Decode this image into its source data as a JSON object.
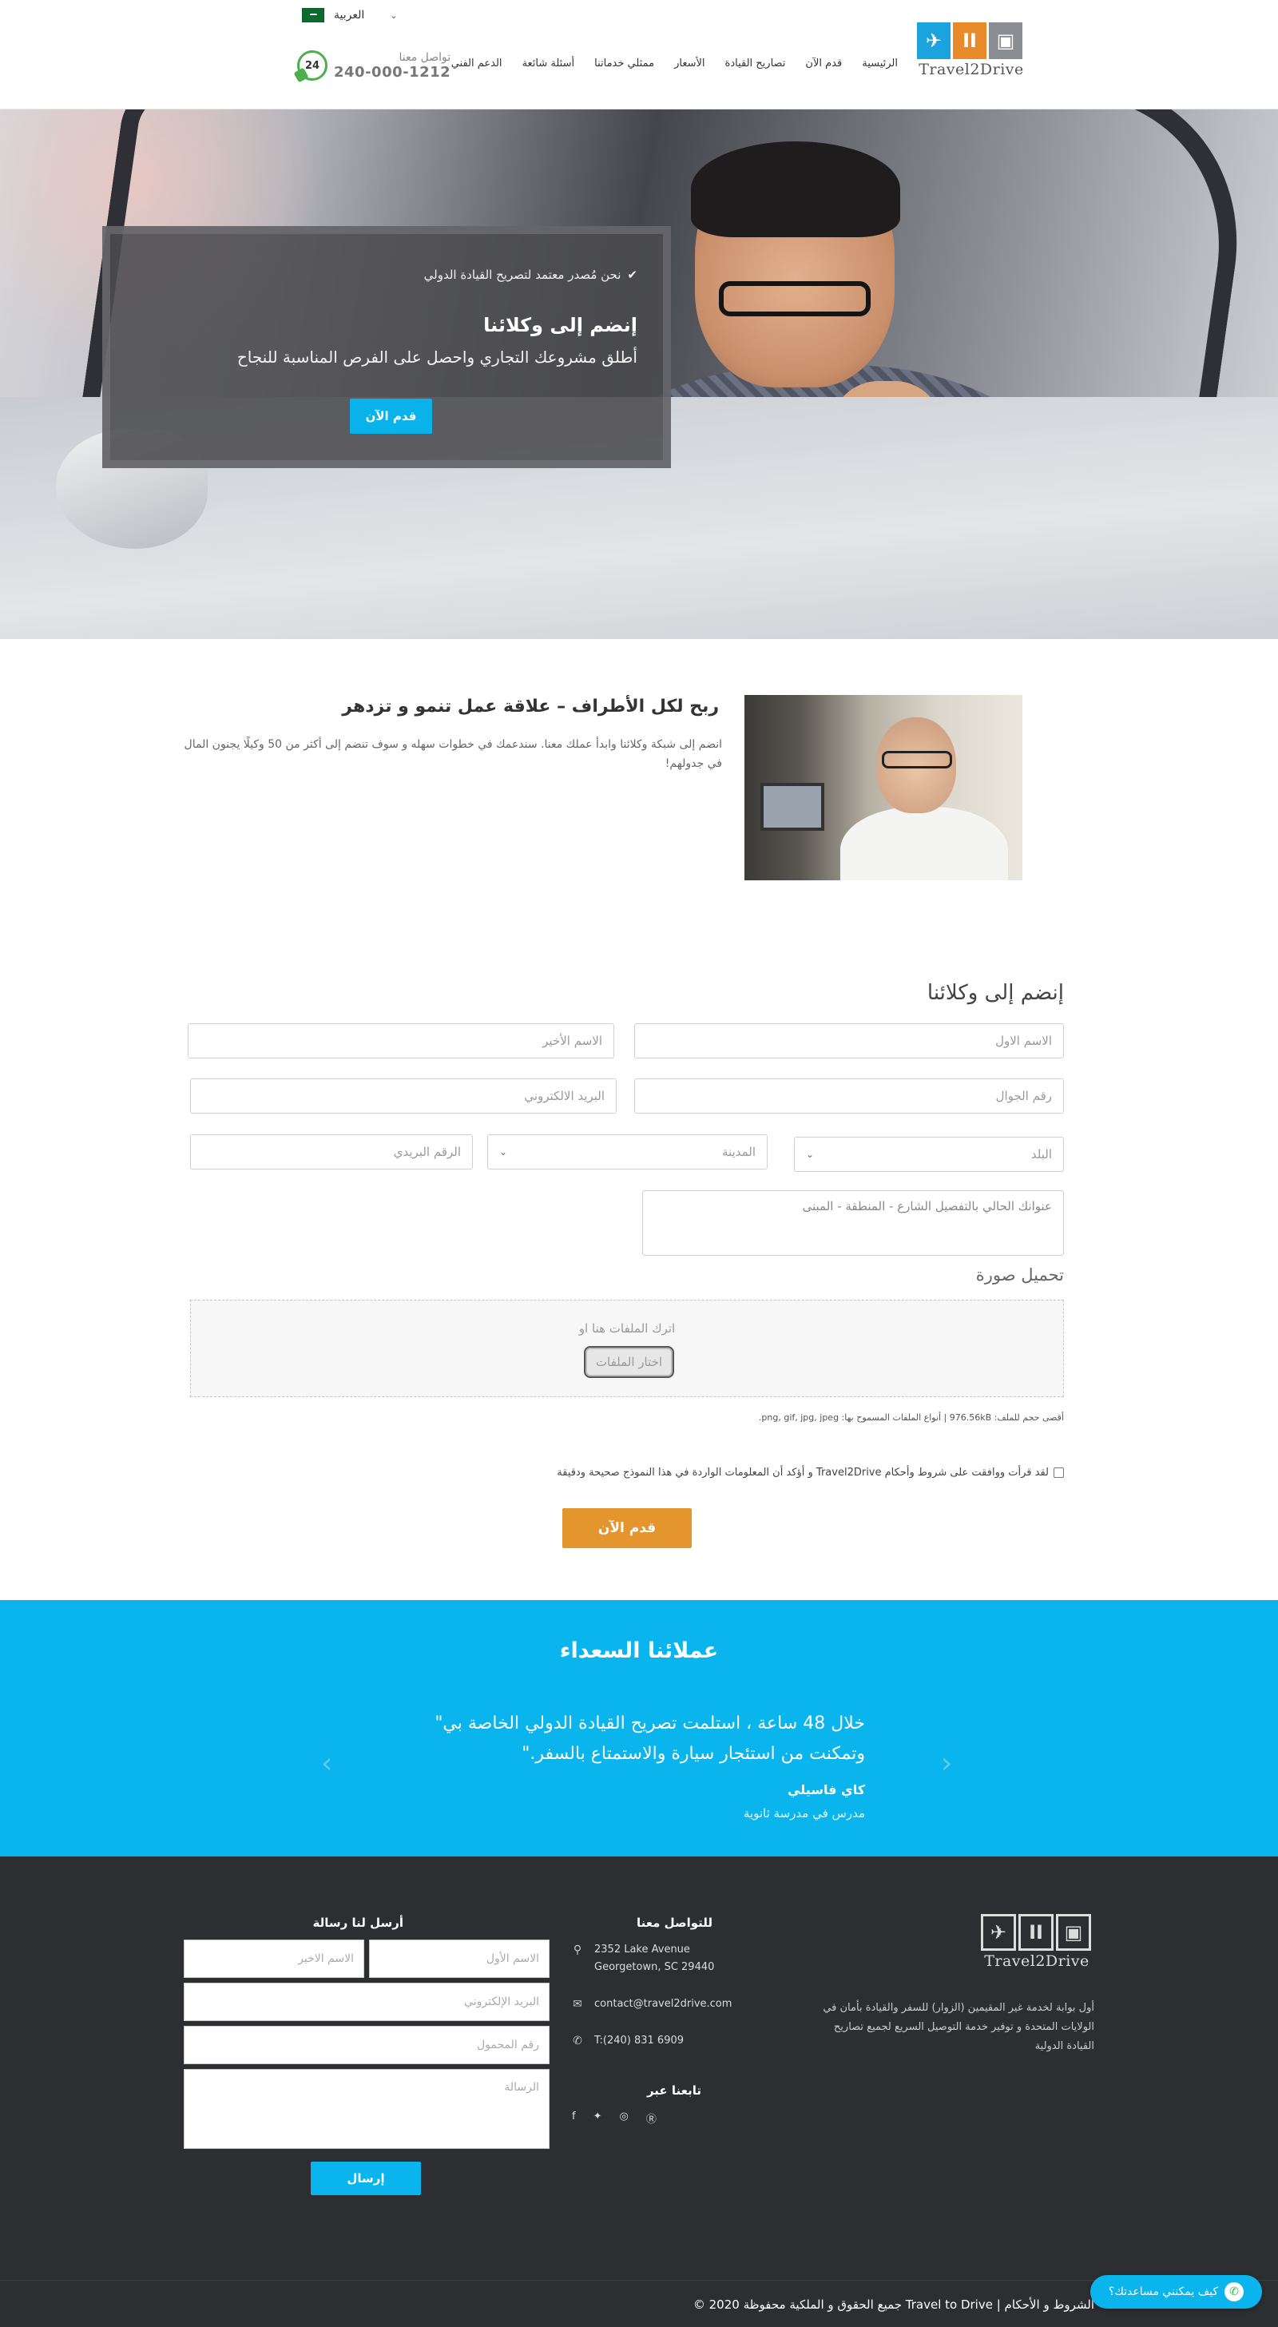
{
  "header": {
    "language": "العربية",
    "phone_label": "تواصل معنا",
    "phone_number": "240-000-1212",
    "phone_badge": "24",
    "nav": [
      "الرئيسية",
      "قدم الآن",
      "تصاريح القيادة",
      "الأسعار",
      "ممثلي خدماتنا",
      "أسئلة شائعة",
      "الدعم الفني"
    ],
    "logo_text": "Travel2Drive",
    "logo_colors": [
      "#1aa3dc",
      "#e8892a",
      "#8a8d92"
    ]
  },
  "hero": {
    "check_text": "نحن مُصدر معتمد لتصريح القيادة الدولي",
    "title": "إنضم إلى وكلائنا",
    "subtitle": "أطلق مشروعك التجاري واحصل على الفرص المناسبة للنجاح",
    "cta": "قدم الآن"
  },
  "partner": {
    "title": "ربح لكل الأطراف – علاقة عمل تنمو و تزدهر",
    "text": "انضم إلى شبكة وكلائنا وابدأ عملك معنا. سندعمك في خطوات سهله و سوف تنضم إلى أكثر من 50 وكيلًا يجنون المال في جدولهم!"
  },
  "form": {
    "title": "إنضم إلى وكلائنا",
    "first_name": "الاسم الاول",
    "last_name": "الاسم الأخير",
    "mobile": "رقم الجوال",
    "email": "البريد الالكتروني",
    "country": "البلد",
    "city": "المدينة",
    "postal": "الرقم البريدي",
    "address": "عنوانك الحالي بالتفصيل الشارع - المنطقة - المبنى",
    "upload_title": "تحميل صورة",
    "drop_text": "اترك الملفات هنا او",
    "choose_files": "اختار الملفات",
    "upload_note": "أقصى حجم للملف: 976.56kB | أنواع الملفات المسموح بها: png, gif, jpg, jpeg.",
    "agree_text": "لقد قرأت ووافقت على شروط وأحكام Travel2Drive و أؤكد أن المعلومات الواردة في هذا النموذج صحيحة ودقيقة",
    "submit": "قدم الآن"
  },
  "testimonials": {
    "title": "عملائنا السعداء",
    "quote": "خلال 48 ساعة ، استلمت تصريح القيادة الدولي الخاصة بي\" وتمكنت من استئجار سيارة والاستمتاع بالسفر.\"",
    "name": "كاي فاسيلي",
    "role": "مدرس في مدرسة ثانوية",
    "prev": "‹",
    "next": "›"
  },
  "footer": {
    "about": "أول بوابة لخدمة غير المقيمين (الزوار) للسفر والقيادة بأمان في الولايات المتحدة و توفير خدمة التوصيل السريع لجميع تصاريح القيادة الدولية",
    "contact_title": "للتواصل معنا",
    "address_line1": "2352 Lake Avenue",
    "address_line2": "Georgetown, SC 29440",
    "email": "contact@travel2drive.com",
    "phone": "T:(240) 831 6909",
    "follow_title": "تابعنا عبر",
    "message_title": "أرسل لنا رسالة",
    "f_first": "الاسم الأول",
    "f_last": "الاسم الاخير",
    "f_email": "البريد الإلكتروني",
    "f_mobile": "رقم المحمول",
    "f_message": "الرسالة",
    "send": "إرسال",
    "copyright": "الشروط و الأحكام | Travel to Drive جميع الحقوق و الملكية محفوظة 2020 ©",
    "whatsapp": "كيف يمكنني مساعدتك؟"
  }
}
